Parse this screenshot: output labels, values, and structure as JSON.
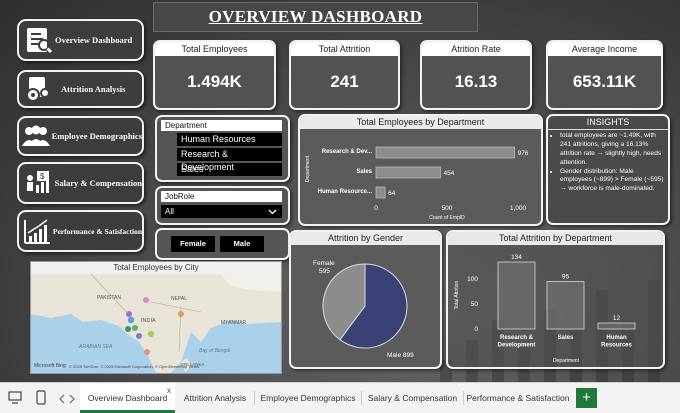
{
  "title": "OVERVIEW DASHBOARD",
  "nav": [
    {
      "label": "Overview Dashboard",
      "icon": "report-icon"
    },
    {
      "label": "Attrition Analysis",
      "icon": "gears-icon"
    },
    {
      "label": "Employee Demographics",
      "icon": "people-icon"
    },
    {
      "label": "Salary & Compensation",
      "icon": "money-icon"
    },
    {
      "label": "Performance & Satisfaction",
      "icon": "growth-chart-icon"
    }
  ],
  "kpis": [
    {
      "label": "Total Employees",
      "value": "1.494K"
    },
    {
      "label": "Total Attrition",
      "value": "241"
    },
    {
      "label": "Atrition Rate",
      "value": "16.13"
    },
    {
      "label": "Average Income",
      "value": "653.11K"
    }
  ],
  "department_slicer": {
    "title": "Department",
    "items": [
      "Human Resources",
      "Research & Development",
      "Sales"
    ]
  },
  "jobrole_slicer": {
    "title": "JobRole",
    "selected": "All"
  },
  "gender_buttons": [
    "Female",
    "Male"
  ],
  "insights": {
    "title": "INSIGHTS",
    "bullets": [
      "total employees are ~1.49K, with 241 attritions, giving a 16.13% attrition rate → slightly high, needs attention.",
      "Gender distribution: Male employees (~899) > Female (~595) → workforce is male-dominated."
    ]
  },
  "map": {
    "title": "Total Employees by City",
    "labels": [
      "PAKISTAN",
      "NEPAL",
      "INDIA",
      "MYANMAR",
      "ARABIAN SEA",
      "Bay of Bengal",
      "SRI LANKA"
    ],
    "attribution": "© 2025 TomTom, © 2025 Microsoft Corporation, © OpenStreetMap  Terms",
    "brand": "Microsoft Bing"
  },
  "chart_data": [
    {
      "type": "bar",
      "title": "Total Employees by Department",
      "ylabel": "Department",
      "xlabel": "Count of EmpID",
      "categories": [
        "Research & Dev...",
        "Sales",
        "Human Resource..."
      ],
      "values": [
        976,
        454,
        64
      ],
      "xticks": [
        "0",
        "500",
        "1,000"
      ],
      "xlim": [
        0,
        1000
      ]
    },
    {
      "type": "pie",
      "title": "Attrition by Gender",
      "categories": [
        "Female",
        "Male"
      ],
      "values": [
        595,
        899
      ],
      "labels": [
        "Female\n595",
        "Male 899"
      ],
      "colors": [
        "#8c8c8c",
        "#3a4275"
      ]
    },
    {
      "type": "bar",
      "title": "Total Attrition by Department",
      "ylabel": "Total Attrition",
      "xlabel": "Department",
      "categories": [
        "Research &\nDevelopment",
        "Sales",
        "Human\nResources"
      ],
      "values": [
        134,
        95,
        12
      ],
      "yticks": [
        "0",
        "50",
        "100"
      ],
      "ylim": [
        0,
        140
      ]
    }
  ],
  "tabs": {
    "items": [
      "Overview Dashboard",
      "Attrition Analysis",
      "Employee Demographics",
      "Salary & Compensation",
      "Performance & Satisfaction"
    ],
    "active": "Overview Dashboard",
    "close_glyph": "x",
    "add_glyph": "+"
  }
}
